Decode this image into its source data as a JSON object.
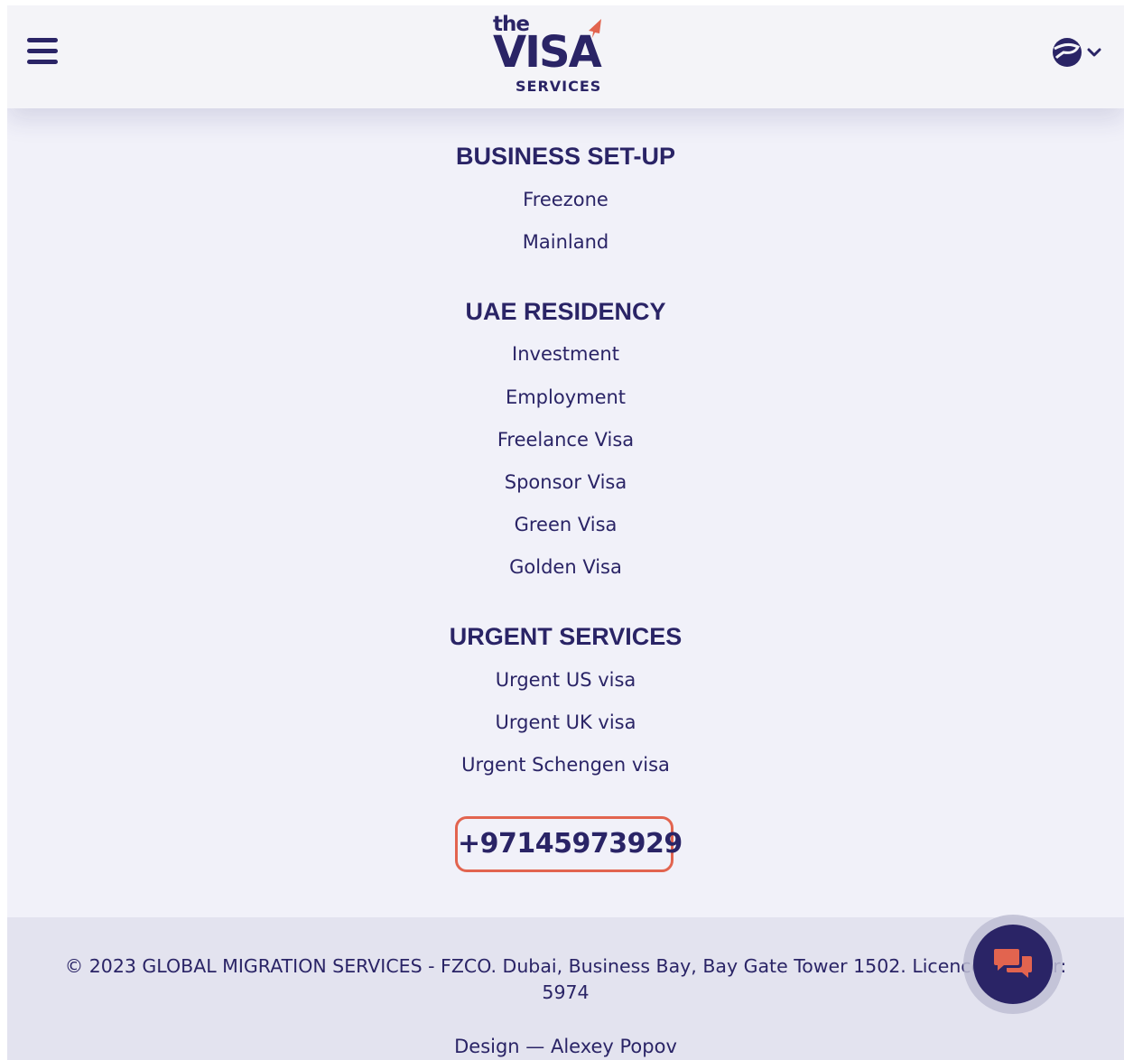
{
  "header": {
    "logo": {
      "the": "the",
      "visa": "VISA",
      "services": "SERVICES"
    },
    "menu_icon": "hamburger-menu-icon",
    "language_icon": "globe-icon"
  },
  "sections": [
    {
      "title": "BUSINESS SET-UP",
      "items": [
        "Freezone",
        "Mainland"
      ]
    },
    {
      "title": "UAE RESIDENCY",
      "items": [
        "Investment",
        "Employment",
        "Freelance Visa",
        "Sponsor Visa",
        "Green Visa",
        "Golden Visa"
      ]
    },
    {
      "title": "URGENT SERVICES",
      "items": [
        "Urgent US visa",
        "Urgent UK visa",
        "Urgent Schengen visa"
      ]
    }
  ],
  "phone": "+97145973929",
  "footer": {
    "copyright_line1": "© 2023 GLOBAL MIGRATION SERVICES - FZCO. Dubai, Business Bay, Bay Gate Tower 1502. Licence number:",
    "copyright_line2": "5974",
    "design_credit": "Design — Alexey Popov"
  },
  "colors": {
    "brand_navy": "#2a2466",
    "accent_coral": "#e2644f",
    "page_bg": "#f1f1f9",
    "footer_bg": "#e3e3ef"
  },
  "chat_button": {
    "icon": "chat-bubbles-icon"
  }
}
